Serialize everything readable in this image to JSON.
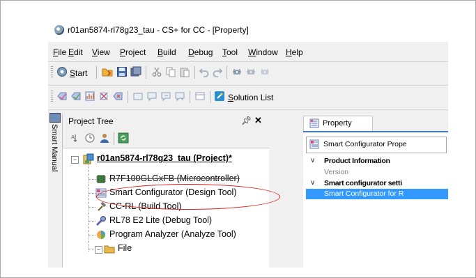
{
  "window": {
    "title": "r01an5874-rl78g23_tau - CS+ for CC - [Property]"
  },
  "menu": [
    {
      "key": "F",
      "rest": "ile",
      "name": "file"
    },
    {
      "key": "E",
      "rest": "dit",
      "name": "edit"
    },
    {
      "key": "V",
      "rest": "iew",
      "name": "view"
    },
    {
      "key": "P",
      "rest": "roject",
      "name": "project"
    },
    {
      "key": "B",
      "rest": "uild",
      "name": "build"
    },
    {
      "key": "D",
      "rest": "ebug",
      "name": "debug"
    },
    {
      "key": "T",
      "rest": "ool",
      "name": "tool"
    },
    {
      "key": "W",
      "rest": "indow",
      "name": "window"
    },
    {
      "key": "H",
      "rest": "elp",
      "name": "help"
    }
  ],
  "toolbar": {
    "start_key": "S",
    "start_rest": "tart",
    "solution_key": "S",
    "solution_rest": "olution List"
  },
  "side_tab": {
    "label": "Smart Manual"
  },
  "project_tree": {
    "title": "Project Tree",
    "pin": "⌦",
    "close": "✕",
    "project": "r01an5874-rl78g23_tau (Project)*",
    "items": [
      "R7F100GLGxFB (Microcontroller)",
      "Smart Configurator (Design Tool)",
      "CC-RL (Build Tool)",
      "RL78 E2 Lite (Debug Tool)",
      "Program Analyzer (Analyze Tool)",
      "File"
    ]
  },
  "property": {
    "tab": "Property",
    "selector": "Smart Configurator Prope",
    "rows": [
      {
        "kind": "cat",
        "chev": "∨",
        "text": "Product Information"
      },
      {
        "kind": "sub",
        "chev": "",
        "text": "Version"
      },
      {
        "kind": "cat",
        "chev": "∨",
        "text": "Smart configurator setti"
      },
      {
        "kind": "sel",
        "chev": "",
        "text": "Smart Configurator for R"
      }
    ]
  },
  "colors": {
    "highlight": "#3399ff",
    "callout": "#d9201d",
    "tab_accent": "#3e7bc7"
  }
}
